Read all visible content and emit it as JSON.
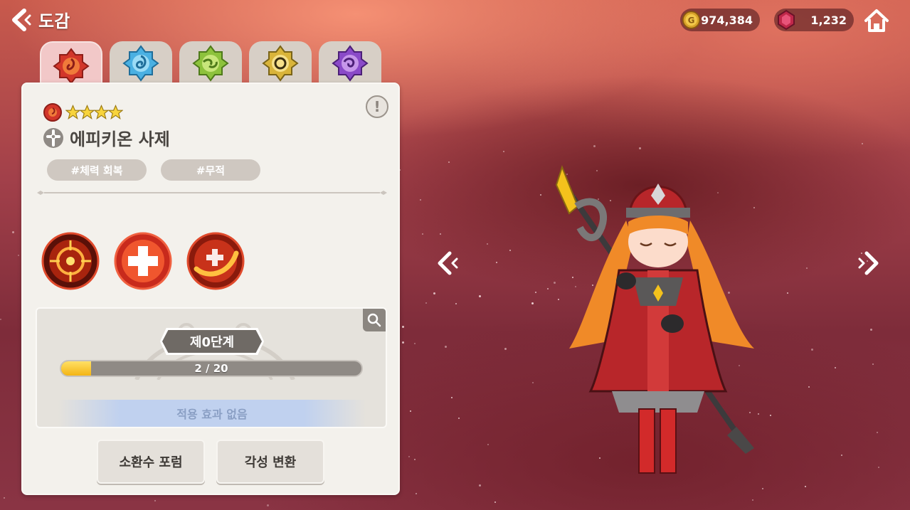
{
  "header": {
    "title": "도감",
    "back_icon": "chevron-left-icon",
    "home_icon": "home-icon"
  },
  "currencies": {
    "gold": {
      "icon": "gold-coin-icon",
      "value": "974,384"
    },
    "gem": {
      "icon": "red-gem-icon",
      "value": "1,232"
    }
  },
  "element_tabs": [
    {
      "element": "fire",
      "active": true,
      "color": "#e04a2c"
    },
    {
      "element": "water",
      "active": false,
      "color": "#3aa6dc"
    },
    {
      "element": "wind",
      "active": false,
      "color": "#8dc23c"
    },
    {
      "element": "light",
      "active": false,
      "color": "#d9b43a"
    },
    {
      "element": "dark",
      "active": false,
      "color": "#8a4ac8"
    }
  ],
  "character": {
    "element_icon": "fire-element-icon",
    "star_count": 4,
    "class_icon": "holy-cross-icon",
    "name": "에피키온 사제",
    "tags": [
      "#체력 회복",
      "#무적"
    ]
  },
  "skills": [
    {
      "icon": "target-burst-skill-icon"
    },
    {
      "icon": "heal-cross-skill-icon"
    },
    {
      "icon": "slash-heal-skill-icon"
    }
  ],
  "progress": {
    "stage_label": "제0단계",
    "current": 2,
    "max": 20,
    "progress_text": "2 / 20",
    "effect_text": "적용 효과 없음"
  },
  "buttons": {
    "summon": "소환수 포럼",
    "awaken": "각성 변환"
  },
  "colors": {
    "accent_fire": "#e04a2c",
    "progress_fill": "#f4b414",
    "panel_bg": "#f3f1ec"
  }
}
